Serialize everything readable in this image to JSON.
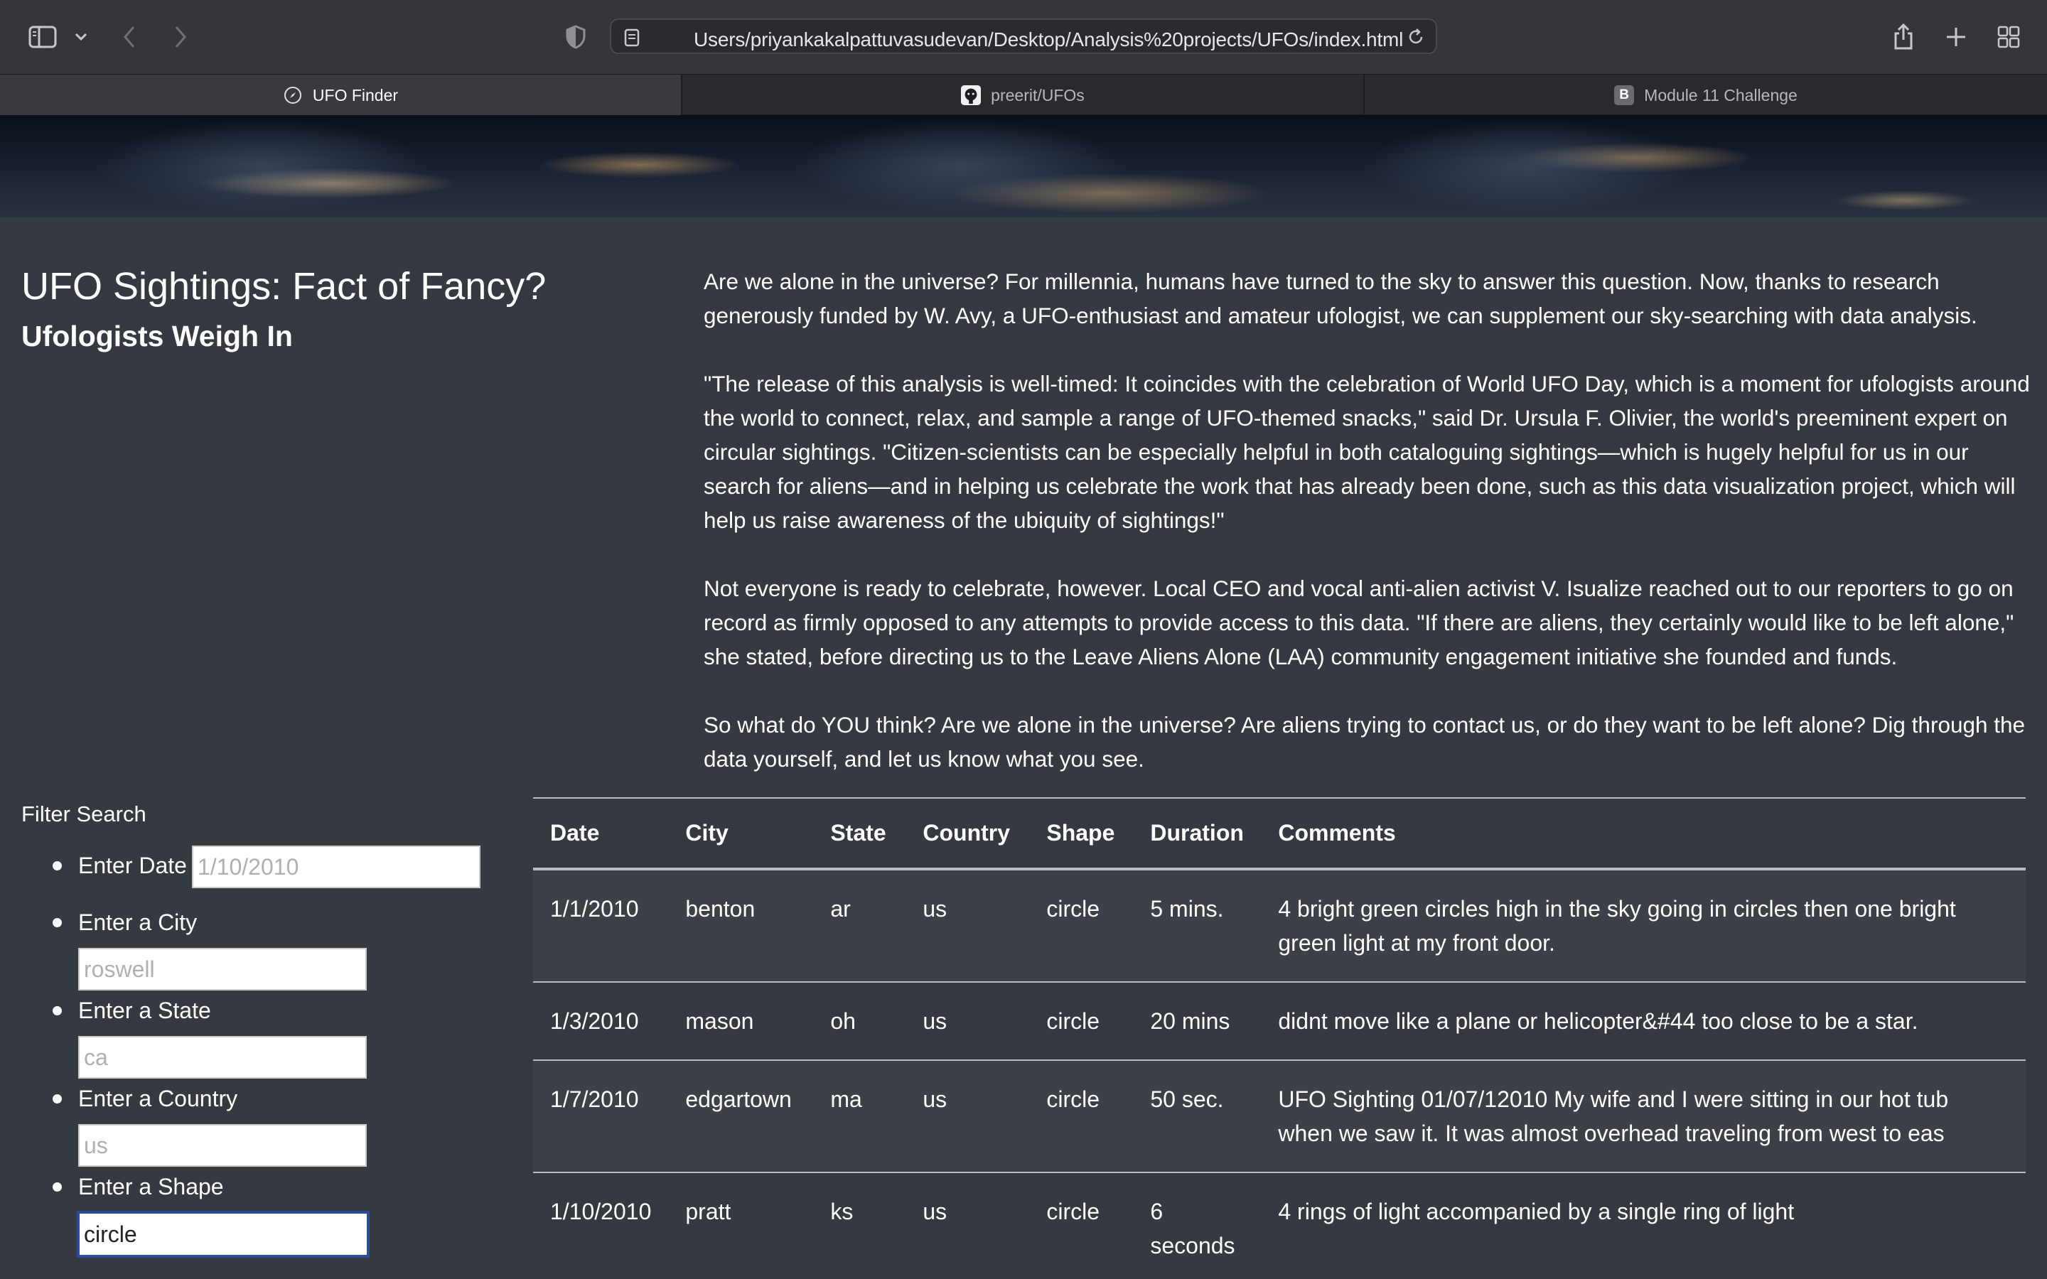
{
  "browser": {
    "url": "Users/priyankakalpattuvasudevan/Desktop/Analysis%20projects/UFOs/index.html",
    "tabs": [
      {
        "label": "UFO Finder",
        "icon": "compass-icon",
        "active": true
      },
      {
        "label": "preerit/UFOs",
        "icon": "github-icon",
        "active": false
      },
      {
        "label": "Module 11 Challenge",
        "icon": "b-badge-icon",
        "badge": "B",
        "active": false
      }
    ]
  },
  "page": {
    "title": "UFO Sightings: Fact of Fancy?",
    "subtitle": "Ufologists Weigh In",
    "paragraphs": [
      "Are we alone in the universe? For millennia, humans have turned to the sky to answer this question. Now, thanks to research generously funded by W. Avy, a UFO-enthusiast and amateur ufologist, we can supplement our sky-searching with data analysis.",
      "\"The release of this analysis is well-timed: It coincides with the celebration of World UFO Day, which is a moment for ufologists around the world to connect, relax, and sample a range of UFO-themed snacks,\" said Dr. Ursula F. Olivier, the world's preeminent expert on circular sightings. \"Citizen-scientists can be especially helpful in both cataloguing sightings—which is hugely helpful for us in our search for aliens—and in helping us celebrate the work that has already been done, such as this data visualization project, which will help us raise awareness of the ubiquity of sightings!\"",
      "Not everyone is ready to celebrate, however. Local CEO and vocal anti-alien activist V. Isualize reached out to our reporters to go on record as firmly opposed to any attempts to provide access to this data. \"If there are aliens, they certainly would like to be left alone,\" she stated, before directing us to the Leave Aliens Alone (LAA) community engagement initiative she founded and funds.",
      "So what do YOU think? Are we alone in the universe? Are aliens trying to contact us, or do they want to be left alone? Dig through the data yourself, and let us know what you see."
    ]
  },
  "filters": {
    "heading": "Filter Search",
    "items": [
      {
        "label": "Enter Date",
        "placeholder": "1/10/2010",
        "value": ""
      },
      {
        "label": "Enter a City",
        "placeholder": "roswell",
        "value": ""
      },
      {
        "label": "Enter a State",
        "placeholder": "ca",
        "value": ""
      },
      {
        "label": "Enter a Country",
        "placeholder": "us",
        "value": ""
      },
      {
        "label": "Enter a Shape",
        "placeholder": "",
        "value": "circle"
      }
    ]
  },
  "table": {
    "headers": [
      "Date",
      "City",
      "State",
      "Country",
      "Shape",
      "Duration",
      "Comments"
    ],
    "rows": [
      [
        "1/1/2010",
        "benton",
        "ar",
        "us",
        "circle",
        "5 mins.",
        "4 bright green circles high in the sky going in circles then one bright green light at my front door."
      ],
      [
        "1/3/2010",
        "mason",
        "oh",
        "us",
        "circle",
        "20 mins",
        "didnt move like a plane or helicopter&#44 too close to be a star."
      ],
      [
        "1/7/2010",
        "edgartown",
        "ma",
        "us",
        "circle",
        "50 sec.",
        "UFO Sighting 01/07/12010 My wife and I were sitting in our hot tub when we saw it. It was almost overhead traveling from west to eas"
      ],
      [
        "1/10/2010",
        "pratt",
        "ks",
        "us",
        "circle",
        "6 seconds",
        "4 rings of light accompanied by a single ring of light"
      ]
    ]
  },
  "colors": {
    "page_background": "#343a40",
    "striped_row": "#3b4147",
    "focus_ring": "#2b4e9b",
    "toolbar": "#36353b"
  }
}
